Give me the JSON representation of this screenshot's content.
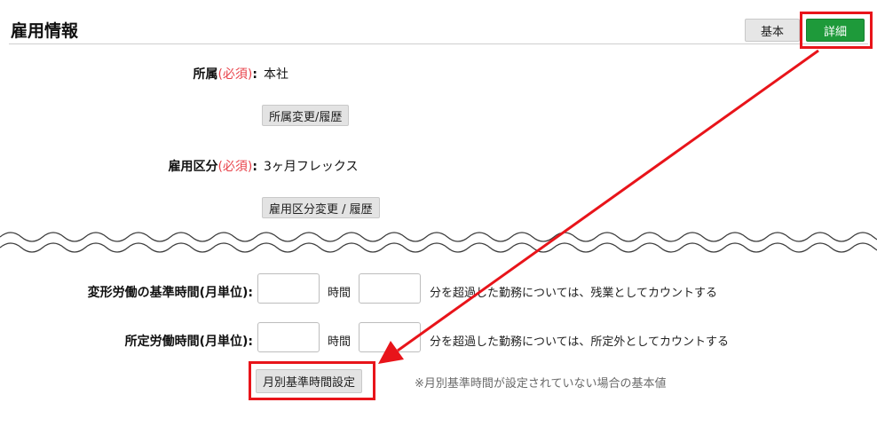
{
  "header": {
    "title": "雇用情報"
  },
  "tabs": {
    "basic": "基本",
    "detail": "詳細"
  },
  "affiliation": {
    "label": "所属",
    "required": "(必須)",
    "colon": ":",
    "value": "本社",
    "change_button": "所属変更/履歴"
  },
  "employment_type": {
    "label": "雇用区分",
    "required": "(必須)",
    "colon": ":",
    "value": "3ヶ月フレックス",
    "change_button": "雇用区分変更 / 履歴"
  },
  "variable_labor": {
    "label": "変形労働の基準時間(月単位):",
    "hours_value": "",
    "hours_unit": "時間",
    "minutes_value": "",
    "description": "分を超過した勤務については、残業としてカウントする"
  },
  "scheduled_labor": {
    "label": "所定労働時間(月単位):",
    "hours_value": "",
    "hours_unit": "時間",
    "minutes_value": "",
    "description": "分を超過した勤務については、所定外としてカウントする"
  },
  "monthly_setting": {
    "button": "月別基準時間設定",
    "note": "※月別基準時間が設定されていない場合の基本値"
  },
  "colors": {
    "highlight": "#e8141a",
    "detail_tab": "#1e9a3a",
    "required": "#e8424a"
  }
}
